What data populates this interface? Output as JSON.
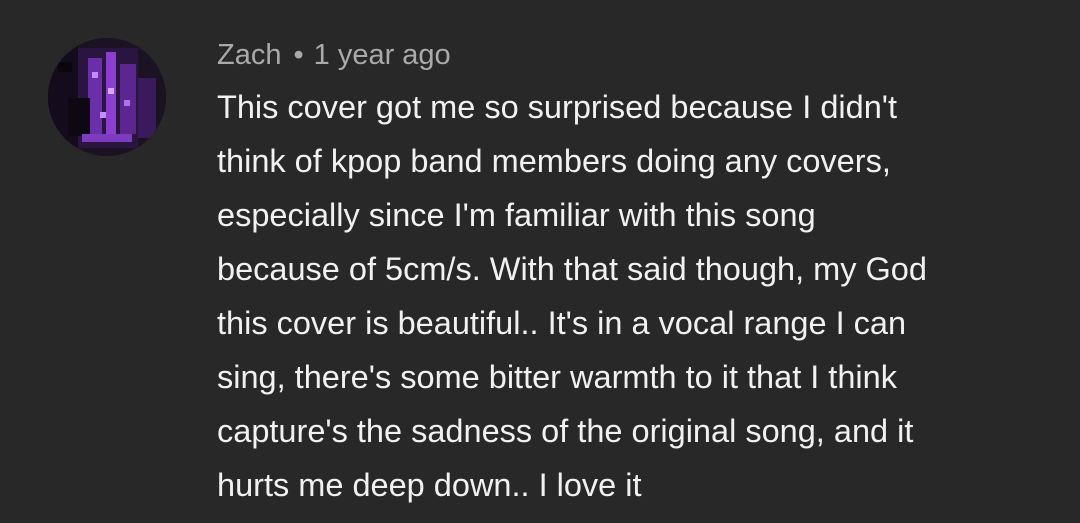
{
  "comment": {
    "author": "Zach",
    "separator": "•",
    "timestamp": "1 year ago",
    "avatar_icon": "user-avatar-icon",
    "lines": [
      "This cover got me so surprised because I didn't",
      "think of kpop band members doing any covers,",
      "especially since I'm familiar with this song",
      "because of 5cm/s. With that said though, my God",
      "this cover is beautiful.. It's in a vocal range I can",
      "sing, there's some bitter warmth to it that I think",
      "capture's the sadness of the original song, and it",
      "hurts me deep down.. I love it"
    ]
  },
  "colors": {
    "background": "#282828",
    "author_text": "#aaaaaa",
    "body_text": "#f1f1f1",
    "avatar_accent": "#8a3fd1"
  }
}
